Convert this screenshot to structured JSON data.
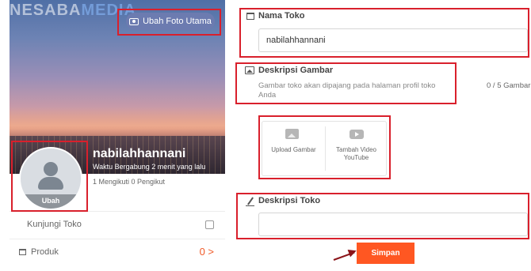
{
  "watermark": {
    "part1": "NESABA",
    "part2": "MEDIA"
  },
  "profile": {
    "change_cover_label": "Ubah Foto Utama",
    "avatar_change_label": "Ubah",
    "shop_name": "nabilahhannani",
    "joined_text": "Waktu Bergabung 2 menit yang lalu",
    "follow_text": "1  Mengikuti   0  Pengikut"
  },
  "menu": {
    "visit_label": "Kunjungi Toko",
    "product_label": "Produk",
    "product_count": "0 >"
  },
  "form": {
    "shop_name_label": "Nama Toko",
    "shop_name_value": "nabilahhannani",
    "image_desc_label": "Deskripsi Gambar",
    "image_desc_helper": "Gambar toko akan dipajang pada halaman profil toko Anda",
    "image_counter": "0 / 5 Gambar",
    "upload_image_label": "Upload Gambar",
    "add_video_label": "Tambah Video YouTube",
    "shop_desc_label": "Deskripsi Toko",
    "shop_desc_value": "",
    "save_label": "Simpan"
  },
  "colors": {
    "accent": "#ff5722",
    "highlight": "#d9202c",
    "cover_button": "#6c7bb0"
  },
  "icons": [
    "camera-icon",
    "user-silhouette-icon",
    "store-icon",
    "image-icon",
    "youtube-icon",
    "pencil-icon",
    "basket-icon",
    "shop-visit-icon"
  ]
}
